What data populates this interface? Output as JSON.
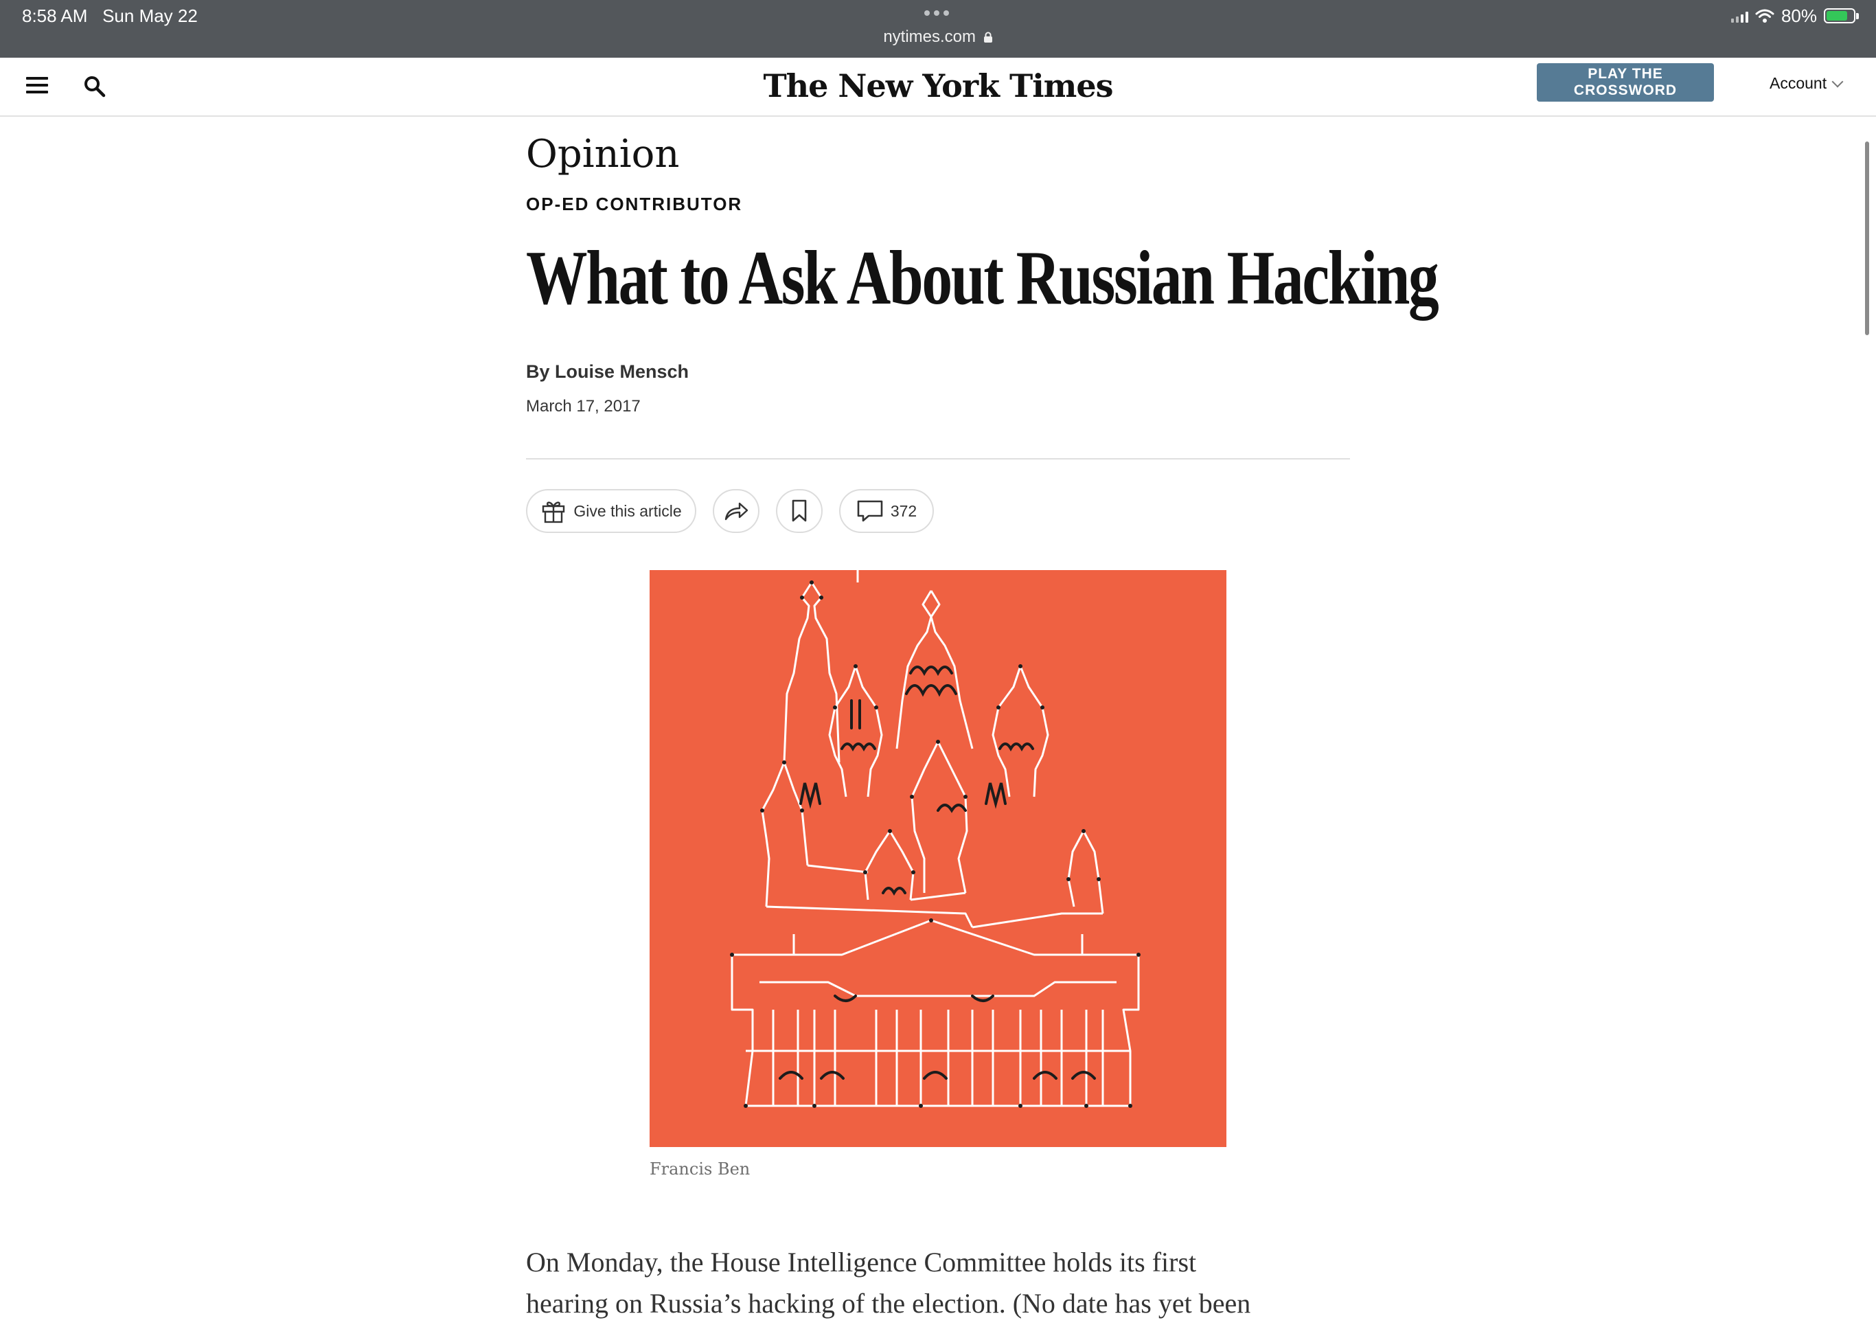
{
  "status_bar": {
    "time": "8:58 AM",
    "date": "Sun May 22",
    "url": "nytimes.com",
    "battery": "80%",
    "battery_color": "#34c759"
  },
  "header": {
    "masthead": "The New York Times",
    "crossword_button": "PLAY THE CROSSWORD",
    "crossword_color": "#567b95",
    "account_label": "Account",
    "icons": [
      "menu-icon",
      "search-icon",
      "chevron-down-icon"
    ]
  },
  "article": {
    "section": "Opinion",
    "kicker": "OP-ED CONTRIBUTOR",
    "headline": "What to Ask About Russian Hacking",
    "byline": "By Louise Mensch",
    "date": "March 17, 2017",
    "actions": {
      "gift_label": "Give this article",
      "comment_count": "372",
      "icons": [
        "gift-icon",
        "share-icon",
        "bookmark-icon",
        "comment-icon"
      ]
    },
    "image": {
      "background_color": "#ef6142",
      "credit": "Francis Ben"
    },
    "body_lines": [
      "On Monday, the House Intelligence Committee holds its first",
      "hearing on Russia’s hacking of the election. (No date has yet been"
    ]
  }
}
